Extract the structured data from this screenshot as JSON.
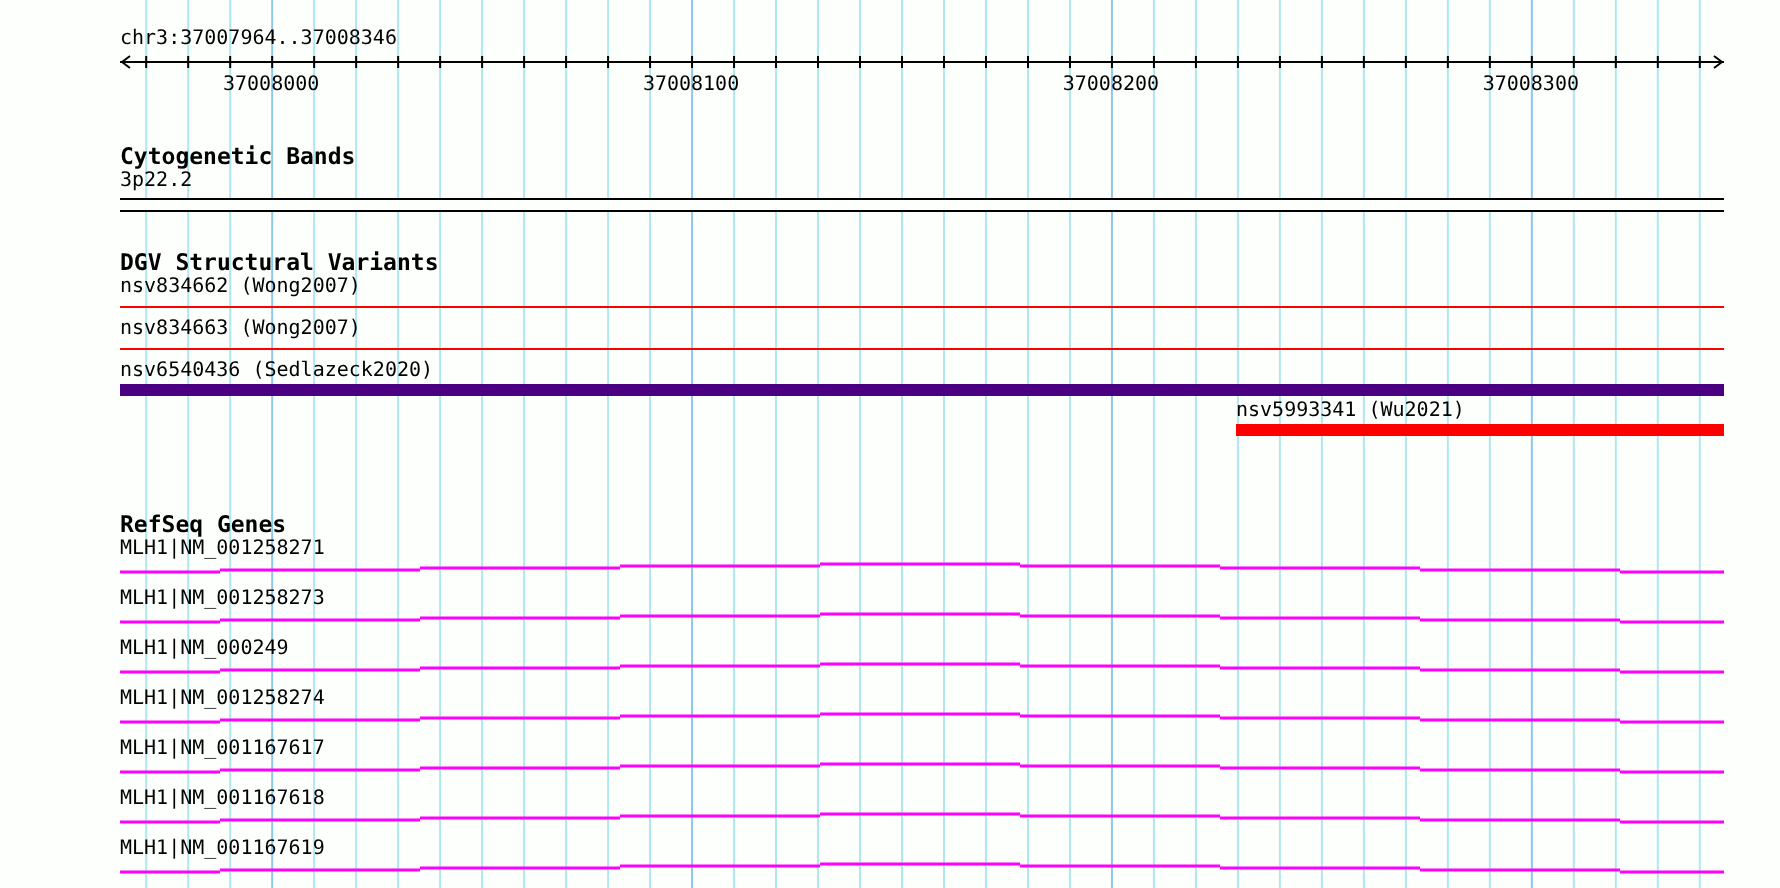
{
  "ruler": {
    "position": "chr3:37007964..37008346",
    "tick_labels": [
      "37008000",
      "37008100",
      "37008200",
      "37008300"
    ]
  },
  "cytogenetic_bands": {
    "title": "Cytogenetic Bands",
    "band": "3p22.2"
  },
  "dgv_structural_variants": {
    "title": "DGV Structural Variants",
    "variants": [
      {
        "label": "nsv834662 (Wong2007)",
        "kind": "line",
        "color": "#ff0000"
      },
      {
        "label": "nsv834663 (Wong2007)",
        "kind": "line",
        "color": "#ff0000"
      },
      {
        "label": "nsv6540436 (Sedlazeck2020)",
        "kind": "bar",
        "color": "#4b0082"
      },
      {
        "label": "nsv5993341 (Wu2021)",
        "kind": "partial",
        "color": "#ff0000"
      }
    ]
  },
  "refseq_genes": {
    "title": "RefSeq Genes",
    "genes": [
      {
        "label": "MLH1|NM_001258271"
      },
      {
        "label": "MLH1|NM_001258273"
      },
      {
        "label": "MLH1|NM_000249"
      },
      {
        "label": "MLH1|NM_001258274"
      },
      {
        "label": "MLH1|NM_001167617"
      },
      {
        "label": "MLH1|NM_001167618"
      },
      {
        "label": "MLH1|NM_001167619"
      }
    ]
  }
}
